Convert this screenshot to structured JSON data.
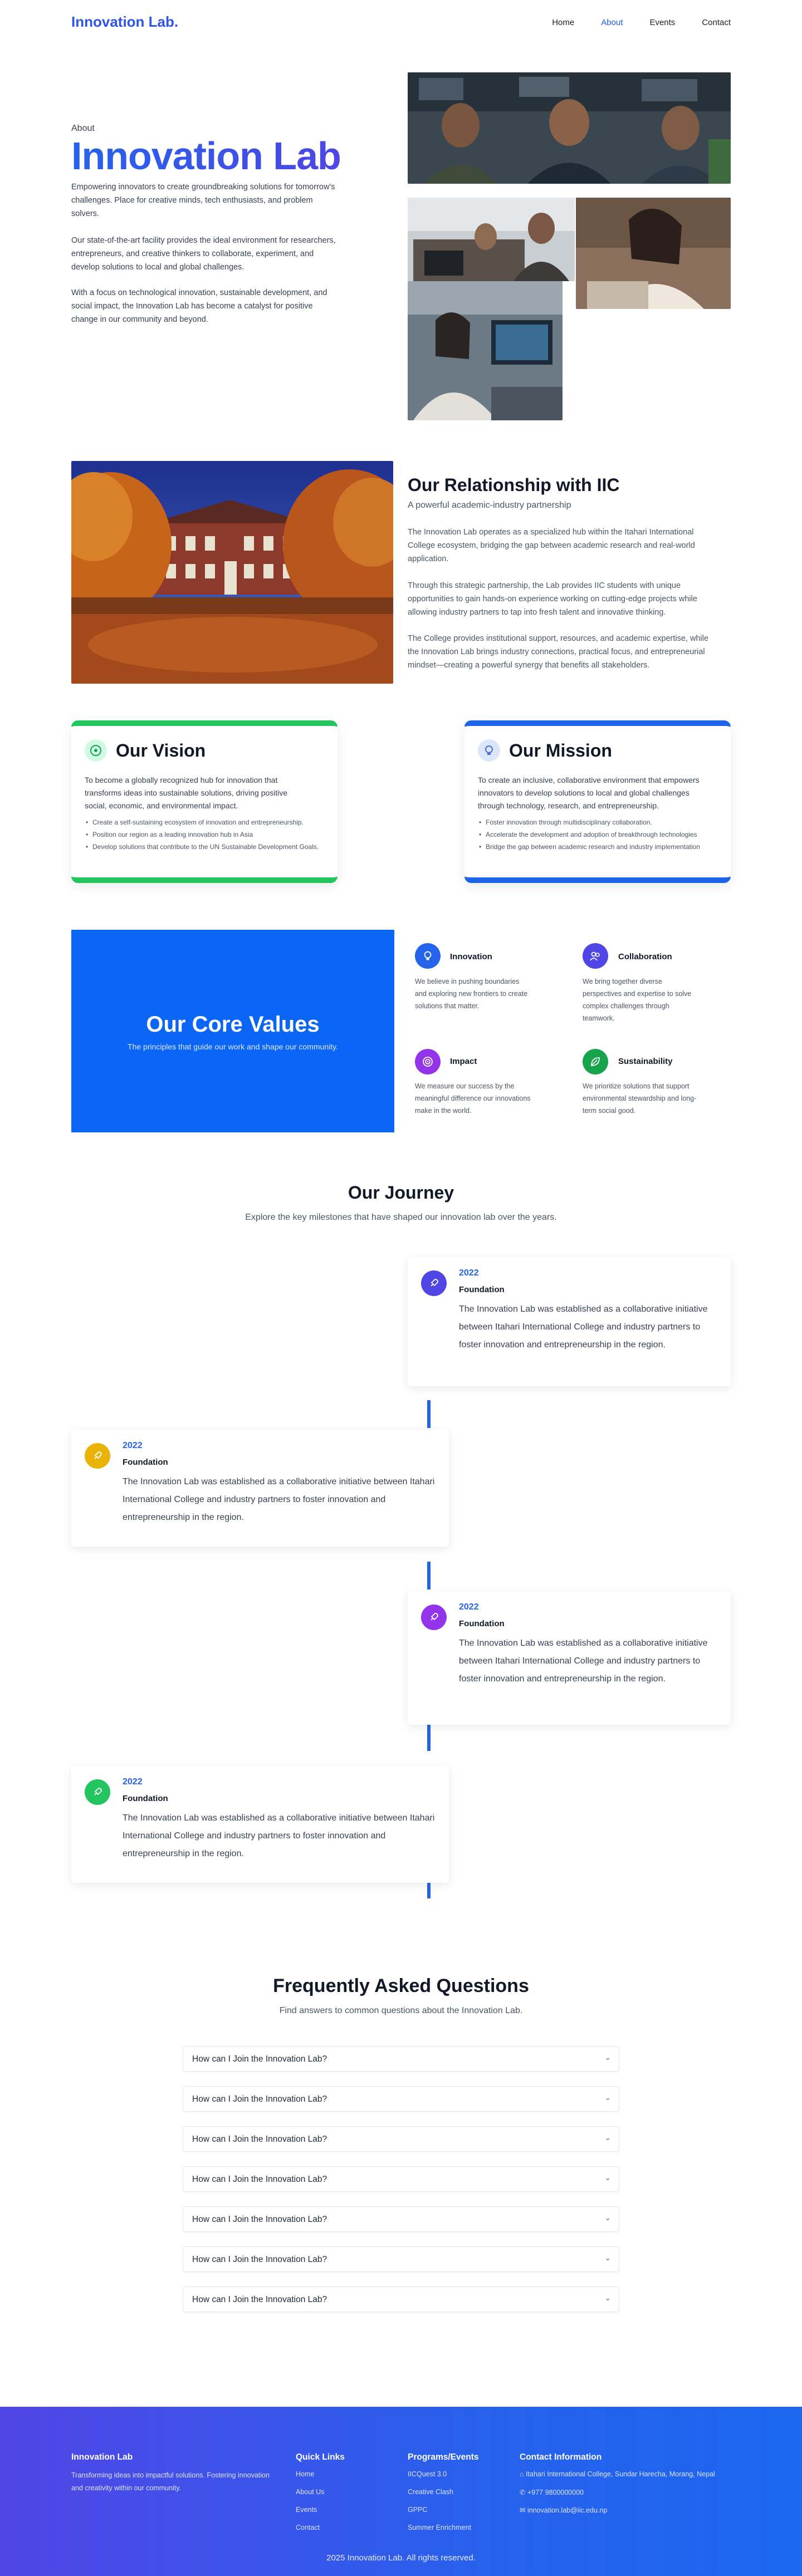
{
  "nav": {
    "brand": "Innovation Lab.",
    "links": [
      "Home",
      "About",
      "Events",
      "Contact"
    ],
    "active": "About"
  },
  "hero": {
    "eyebrow": "About",
    "title": "Innovation Lab",
    "paragraphs": [
      "Empowering innovators to create groundbreaking solutions for tomorrow's challenges. Place for creative minds, tech enthusiasts, and problem solvers.",
      "Our state-of-the-art facility provides the ideal environment for researchers, entrepreneurs, and creative thinkers to collaborate, experiment, and develop solutions to local and global challenges.",
      "With a focus on technological innovation, sustainable development, and social impact, the Innovation Lab has become a catalyst for positive change in our community and beyond."
    ]
  },
  "relationship": {
    "title": "Our Relationship with IIC",
    "subtitle": "A powerful academic-industry partnership",
    "paragraphs": [
      "The Innovation Lab operates as a specialized hub within the Itahari International College ecosystem, bridging the gap between academic research and real-world application.",
      "Through this strategic partnership, the Lab provides IIC students with unique opportunities to gain hands-on experience working on cutting-edge projects while allowing industry partners to tap into fresh talent and innovative thinking.",
      "The College provides institutional support, resources, and academic expertise, while the Innovation Lab brings industry connections, practical focus, and entrepreneurial mindset—creating a powerful synergy that benefits all stakeholders."
    ]
  },
  "vision": {
    "title": "Our Vision",
    "text": "To become a globally recognized hub for innovation that transforms ideas into sustainable solutions, driving positive social, economic, and environmental impact.",
    "items": [
      "Create a self-sustaining ecosystem of innovation and entrepreneurship.",
      "Position our region as a leading innovation hub in Asia",
      "Develop solutions that contribute to the UN Sustainable Development Goals."
    ]
  },
  "mission": {
    "title": "Our Mission",
    "text": "To create an inclusive, collaborative environment that empowers innovators to develop solutions to local and global challenges through technology, research, and entrepreneurship.",
    "items": [
      "Foster innovation through multidisciplinary collaboration.",
      "Accelerate the development and adoption of breakthrough technologies",
      "Bridge the gap between academic research and industry implementation"
    ]
  },
  "core_values": {
    "title": "Our Core Values",
    "subtitle": "The principles that guide our work and shape our community.",
    "values": [
      {
        "title": "Innovation",
        "text": "We believe in pushing boundaries and exploring new frontiers to create solutions that matter.",
        "color": "#2563eb",
        "icon": "lightbulb-icon"
      },
      {
        "title": "Collaboration",
        "text": "We bring together diverse perspectives and expertise to solve complex challenges through teamwork.",
        "color": "#4f46e5",
        "icon": "users-icon"
      },
      {
        "title": "Impact",
        "text": "We measure our success by the meaningful difference our innovations make in the world.",
        "color": "#9333ea",
        "icon": "target-icon"
      },
      {
        "title": "Sustainability",
        "text": "We prioritize solutions that support environmental stewardship and long-term social good.",
        "color": "#16a34a",
        "icon": "leaf-icon"
      }
    ]
  },
  "journey": {
    "title": "Our Journey",
    "subtitle": "Explore the key milestones that have shaped our innovation lab over the years.",
    "items": [
      {
        "year": "2022",
        "label": "Foundation",
        "text": "The Innovation Lab was established as a collaborative initiative between Itahari International College and industry partners to foster innovation and entrepreneurship in the region.",
        "color": "#4f46e5"
      },
      {
        "year": "2022",
        "label": "Foundation",
        "text": "The Innovation Lab was established as a collaborative initiative between Itahari International College and industry partners to foster innovation and entrepreneurship in the region.",
        "color": "#eab308"
      },
      {
        "year": "2022",
        "label": "Foundation",
        "text": "The Innovation Lab was established as a collaborative initiative between Itahari International College and industry partners to foster innovation and entrepreneurship in the region.",
        "color": "#9333ea"
      },
      {
        "year": "2022",
        "label": "Foundation",
        "text": "The Innovation Lab was established as a collaborative initiative between Itahari International College and industry partners to foster innovation and entrepreneurship in the region.",
        "color": "#22c55e"
      }
    ]
  },
  "faq": {
    "title": "Frequently Asked Questions",
    "subtitle": "Find answers to common questions about the Innovation Lab.",
    "questions": [
      "How can I Join the Innovation Lab?",
      "How can I Join the Innovation Lab?",
      "How can I Join the Innovation Lab?",
      "How can I Join the Innovation Lab?",
      "How can I Join the Innovation Lab?",
      "How can I Join the Innovation Lab?",
      "How can I Join the Innovation Lab?"
    ]
  },
  "footer": {
    "brand": "Innovation Lab",
    "tagline": "Transforming ideas into impactful solutions. Fostering innovation and creativity within our community.",
    "quick_links_title": "Quick Links",
    "quick_links": [
      "Home",
      "About Us",
      "Events",
      "Contact"
    ],
    "programs_title": "Programs/Events",
    "programs": [
      "IICQuest 3.0",
      "Creative Clash",
      "GPPC",
      "Summer Enrichment"
    ],
    "contact_title": "Contact Information",
    "address": "Itahari International College, Sundar Harecha, Morang, Nepal",
    "phone": "+977 9800000000",
    "email": "innovation.lab@iic.edu.np",
    "copyright": "2025 Innovation Lab. All rights reserved."
  }
}
